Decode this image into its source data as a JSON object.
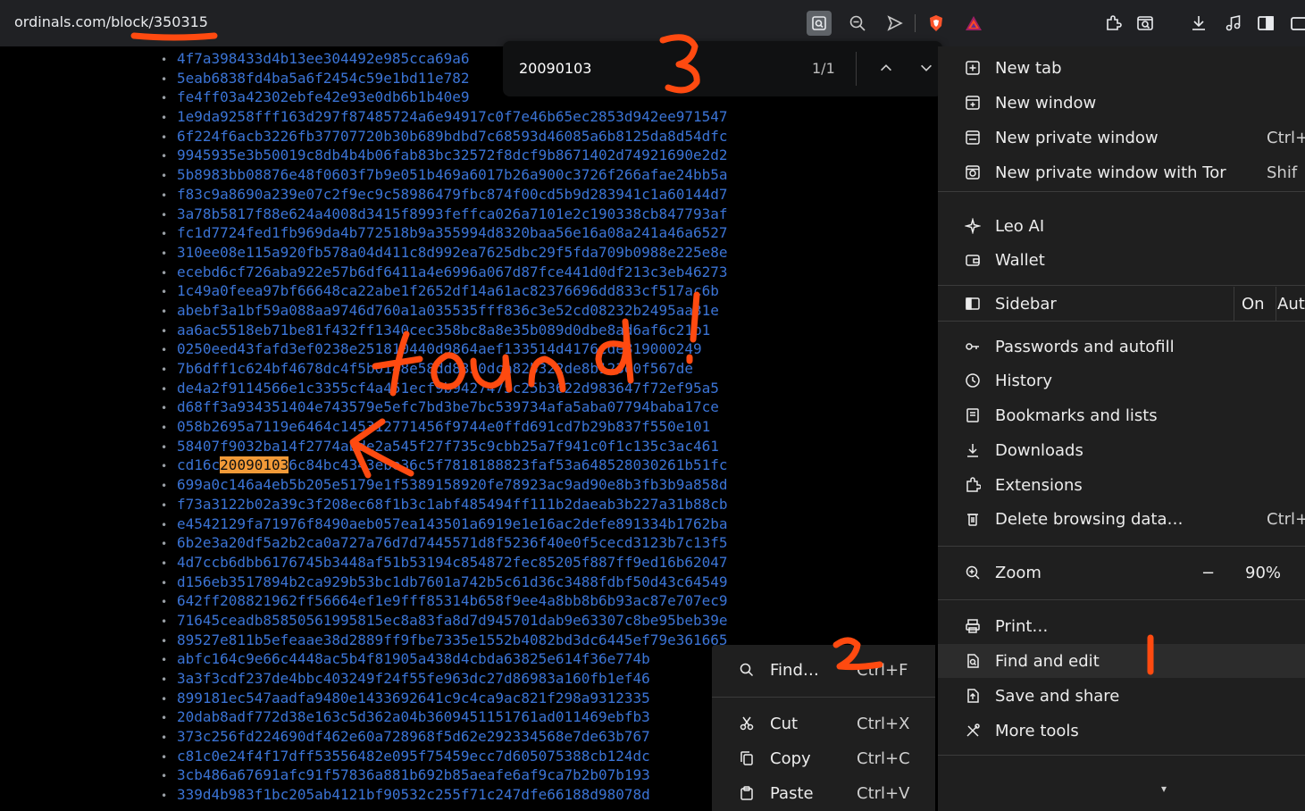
{
  "address_bar": {
    "url": "ordinals.com/block/350315"
  },
  "toolbar": {
    "icons": [
      "find-in-page-icon",
      "zoom-icon",
      "send-icon",
      "brave-shields-icon",
      "brave-rewards-icon",
      "extensions-icon",
      "tab-search-icon",
      "downloads-icon",
      "media-icon",
      "sidebar-icon",
      "wallet-icon"
    ]
  },
  "find_bar": {
    "query": "20090103",
    "count": "1/1"
  },
  "transactions": [
    {
      "before": "4f7a398433d4b13ee304492e985cca69a6",
      "match": "",
      "after": ""
    },
    {
      "before": "5eab6838fd4ba5a6f2454c59e1bd11e782",
      "match": "",
      "after": ""
    },
    {
      "before": "fe4ff03a42302ebfe42e93e0db6b1b40e9",
      "match": "",
      "after": ""
    },
    {
      "before": "1e9da9258fff163d297f87485724a6e94917c0f7e46b65ec2853d942ee971547",
      "match": "",
      "after": ""
    },
    {
      "before": "6f224f6acb3226fb37707720b30b689bdbd7c68593d46085a6b8125da8d54dfc",
      "match": "",
      "after": ""
    },
    {
      "before": "9945935e3b50019c8db4b4b06fab83bc32572f8dcf9b8671402d74921690e2d2",
      "match": "",
      "after": ""
    },
    {
      "before": "5b8983bb08876e48f0603f7b9e051b469a6017b26a900c3726f266afae24bb5a",
      "match": "",
      "after": ""
    },
    {
      "before": "f83c9a8690a239e07c2f9ec9c58986479fbc874f00cd5b9d283941c1a60144d7",
      "match": "",
      "after": ""
    },
    {
      "before": "3a78b5817f88e624a4008d3415f8993feffca026a7101e2c190338cb847793af",
      "match": "",
      "after": ""
    },
    {
      "before": "fc1d7724fed1fb969da4b772518b9a355994d8320baa56e16a08a241a46a6527",
      "match": "",
      "after": ""
    },
    {
      "before": "310ee08e115a920fb578a04d411c8d992ea7625dbc29f5fda709b0988e225e8e",
      "match": "",
      "after": ""
    },
    {
      "before": "ecebd6cf726aba922e57b6df6411a4e6996a067d87fce441d0df213c3eb46273",
      "match": "",
      "after": ""
    },
    {
      "before": "1c49a0feea97bf66648ca22abe1f2652df14a61ac82376696dd833cf517ac6b",
      "match": "",
      "after": ""
    },
    {
      "before": "abebf3a1bf59a088aa9746d760a1a035535fff836c3e52cd08232b2495aa31e",
      "match": "",
      "after": ""
    },
    {
      "before": "aa6ac5518eb71be81f432ff1340cec358bc8a8e35b089d0dbe8ad6af6c21b1",
      "match": "",
      "after": ""
    },
    {
      "before": "0250eed43fafd3ef0238e251810440d9864aef133514d4176cde819000249",
      "match": "",
      "after": ""
    },
    {
      "before": "7b6dff1c624bf4678dc4f5b0148e58dd8330dca82b322de8b123e0f567de",
      "match": "",
      "after": ""
    },
    {
      "before": "de4a2f9114566e1c3355cf4a451ecf9b9427475c25b3622d983647f72ef95a5",
      "match": "",
      "after": ""
    },
    {
      "before": "d68ff3a934351404e743579e5efc7bd3be7bc539734afa5aba07794baba17ce",
      "match": "",
      "after": ""
    },
    {
      "before": "058b2695a7119e6464c145312771456f9744e0ffd691cd7b29b837f550e101",
      "match": "",
      "after": ""
    },
    {
      "before": "58407f9032ba14f2774abde2a545f27f735c9cbb25a7f941c0f1c135c3ac461",
      "match": "",
      "after": ""
    },
    {
      "before": "cd16c",
      "match": "20090103",
      "after": "6c84bc4343ebe36c5f7818188823faf53a648528030261b51fc"
    },
    {
      "before": "699a0c146a4eb5b205e5179e1f5389158920fe78923ac9ad90e8b3fb3b9a858d",
      "match": "",
      "after": ""
    },
    {
      "before": "f73a3122b02a39c3f208ec68f1b3c1abf485494ff111b2daeab3b227a31b88cb",
      "match": "",
      "after": ""
    },
    {
      "before": "e4542129fa71976f8490aeb057ea143501a6919e1e16ac2defe891334b1762ba",
      "match": "",
      "after": ""
    },
    {
      "before": "6b2e3a20df5a2b2ca0a727a76d7d7445571d8f5236f40e0f5cecd3123b7c13f5",
      "match": "",
      "after": ""
    },
    {
      "before": "4d7ccb6dbb6176745b3448af51b53194c854872fec85205f887ff9ed16b62047",
      "match": "",
      "after": ""
    },
    {
      "before": "d156eb3517894b2ca929b53bc1db7601a742b5c61d36c3488fdbf50d43c64549",
      "match": "",
      "after": ""
    },
    {
      "before": "642ff208821962ff56664ef1e9fff85314b658f9ee4a8bb8b6b93ac87e707ec9",
      "match": "",
      "after": ""
    },
    {
      "before": "71645ceadb85850561995815ec8a83fa8d7d945701dab9e63307c8be95beb39e",
      "match": "",
      "after": ""
    },
    {
      "before": "89527e811b5efeaae38d2889ff9fbe7335e1552b4082bd3dc6445ef79e361665",
      "match": "",
      "after": ""
    },
    {
      "before": "abfc164c9e66c4448ac5b4f81905a438d4cbda63825e614f36e774b",
      "match": "",
      "after": ""
    },
    {
      "before": "3a3f3cdf237de4bbc403249f24f55fe963dc27d86983a160fb1ef46",
      "match": "",
      "after": ""
    },
    {
      "before": "899181ec547aadfa9480e1433692641c9c4ca9ac821f298a9312335",
      "match": "",
      "after": ""
    },
    {
      "before": "20dab8adf772d38e163c5d362a04b3609451151761ad011469ebfb3",
      "match": "",
      "after": ""
    },
    {
      "before": "373c256fd224690df462e60a728968f5d62e292334568e7de63b767",
      "match": "",
      "after": ""
    },
    {
      "before": "c81c0e24f4f17dff53556482e095f75459ecc7d605075388cb124dc",
      "match": "",
      "after": ""
    },
    {
      "before": "3cb486a67691afc91f57836a881b692b85aeafe6af9ca7b2b07b193",
      "match": "",
      "after": ""
    },
    {
      "before": "339d4b983f1bc205ab4121bf90532c255f71c247dfe66188d98078d",
      "match": "",
      "after": ""
    }
  ],
  "menu": {
    "items": [
      {
        "id": "new-tab",
        "label": "New tab",
        "shortcut": "",
        "icon": "new-tab-icon"
      },
      {
        "id": "new-window",
        "label": "New window",
        "shortcut": "",
        "icon": "new-window-icon"
      },
      {
        "id": "new-private-window",
        "label": "New private window",
        "shortcut": "Ctrl+",
        "icon": "private-window-icon"
      },
      {
        "id": "new-private-tor",
        "label": "New private window with Tor",
        "shortcut": "Shif",
        "icon": "tor-window-icon"
      },
      {
        "id": "leo-ai",
        "label": "Leo AI",
        "shortcut": "",
        "icon": "leo-ai-icon"
      },
      {
        "id": "wallet",
        "label": "Wallet",
        "shortcut": "",
        "icon": "wallet-icon"
      },
      {
        "id": "sidebar",
        "label": "Sidebar",
        "shortcut": "",
        "icon": "sidebar-icon"
      },
      {
        "id": "passwords",
        "label": "Passwords and autofill",
        "shortcut": "",
        "icon": "key-icon"
      },
      {
        "id": "history",
        "label": "History",
        "shortcut": "",
        "icon": "history-icon"
      },
      {
        "id": "bookmarks",
        "label": "Bookmarks and lists",
        "shortcut": "",
        "icon": "bookmark-icon"
      },
      {
        "id": "downloads",
        "label": "Downloads",
        "shortcut": "",
        "icon": "download-icon"
      },
      {
        "id": "extensions",
        "label": "Extensions",
        "shortcut": "",
        "icon": "puzzle-icon"
      },
      {
        "id": "delete-data",
        "label": "Delete browsing data…",
        "shortcut": "Ctrl+Sh",
        "icon": "trash-icon"
      },
      {
        "id": "zoom",
        "label": "Zoom",
        "shortcut": "",
        "icon": "zoom-icon"
      },
      {
        "id": "print",
        "label": "Print…",
        "shortcut": "",
        "icon": "print-icon"
      },
      {
        "id": "find-edit",
        "label": "Find and edit",
        "shortcut": "",
        "icon": "find-edit-icon"
      },
      {
        "id": "save-share",
        "label": "Save and share",
        "shortcut": "",
        "icon": "share-icon"
      },
      {
        "id": "more-tools",
        "label": "More tools",
        "shortcut": "",
        "icon": "tools-icon"
      }
    ],
    "sidebar_on": "On",
    "sidebar_auto": "Aut",
    "zoom_minus": "−",
    "zoom_value": "90%"
  },
  "submenu": {
    "items": [
      {
        "id": "find",
        "label": "Find…",
        "shortcut": "Ctrl+F",
        "icon": "search-icon"
      },
      {
        "id": "cut",
        "label": "Cut",
        "shortcut": "Ctrl+X",
        "icon": "scissors-icon"
      },
      {
        "id": "copy",
        "label": "Copy",
        "shortcut": "Ctrl+C",
        "icon": "copy-icon"
      },
      {
        "id": "paste",
        "label": "Paste",
        "shortcut": "Ctrl+V",
        "icon": "paste-icon"
      }
    ]
  },
  "annotations": {
    "found_text": "found!",
    "step1": "1",
    "step2": "2",
    "step3": "3",
    "color": "#ff4a10"
  }
}
